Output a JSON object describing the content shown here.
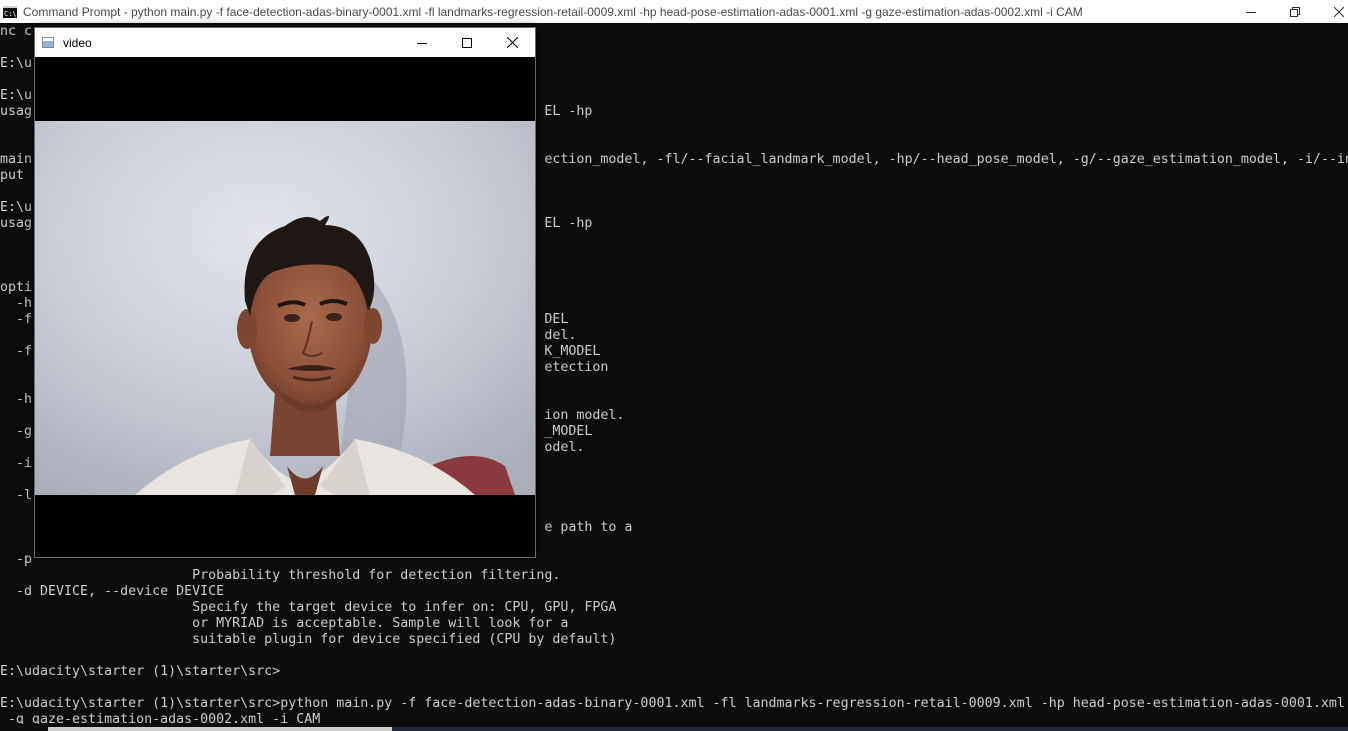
{
  "console": {
    "title": "Command Prompt - python  main.py -f face-detection-adas-binary-0001.xml -fl landmarks-regression-retail-0009.xml -hp head-pose-estimation-adas-0001.xml -g gaze-estimation-adas-0002.xml -i CAM",
    "icon": "cmd-icon",
    "lines": [
      "nc c",
      "",
      "E:\\u",
      "",
      "E:\\u",
      "usag                                                                EL -hp",
      "",
      "",
      "main                                                                ection_model, -fl/--facial_landmark_model, -hp/--head_pose_model, -g/--gaze_estimation_model, -i/--in",
      "put",
      "",
      "E:\\u",
      "usag                                                                EL -hp",
      "",
      "",
      "",
      "opti",
      "  -h",
      "  -f                                                                DEL",
      "                                                                    del.",
      "  -f                                                                K_MODEL",
      "                                                                    etection",
      "",
      "  -h",
      "                                                                    ion model.",
      "  -g                                                                _MODEL",
      "                                                                    odel.",
      "  -i",
      "",
      "  -l",
      "",
      "                                                                    e path to a",
      "",
      "  -p",
      "                        Probability threshold for detection filtering.",
      "  -d DEVICE, --device DEVICE",
      "                        Specify the target device to infer on: CPU, GPU, FPGA",
      "                        or MYRIAD is acceptable. Sample will look for a",
      "                        suitable plugin for device specified (CPU by default)",
      "",
      "E:\\udacity\\starter (1)\\starter\\src>",
      "",
      "E:\\udacity\\starter (1)\\starter\\src>python main.py -f face-detection-adas-binary-0001.xml -fl landmarks-regression-retail-0009.xml -hp head-pose-estimation-adas-0001.xml",
      " -g gaze-estimation-adas-0002.xml -i CAM"
    ],
    "controls": {
      "minimize": "minimize-icon",
      "restore": "restore-icon",
      "close": "close-icon"
    },
    "colors": {
      "background": "#0c0c0c",
      "text": "#cccccc",
      "title_bar": "#ffffff"
    }
  },
  "video_window": {
    "title": "video",
    "icon": "app-window-icon",
    "controls": {
      "minimize": "minimize-icon",
      "maximize": "maximize-icon",
      "close": "close-icon"
    },
    "frame": "webcam-frame"
  }
}
